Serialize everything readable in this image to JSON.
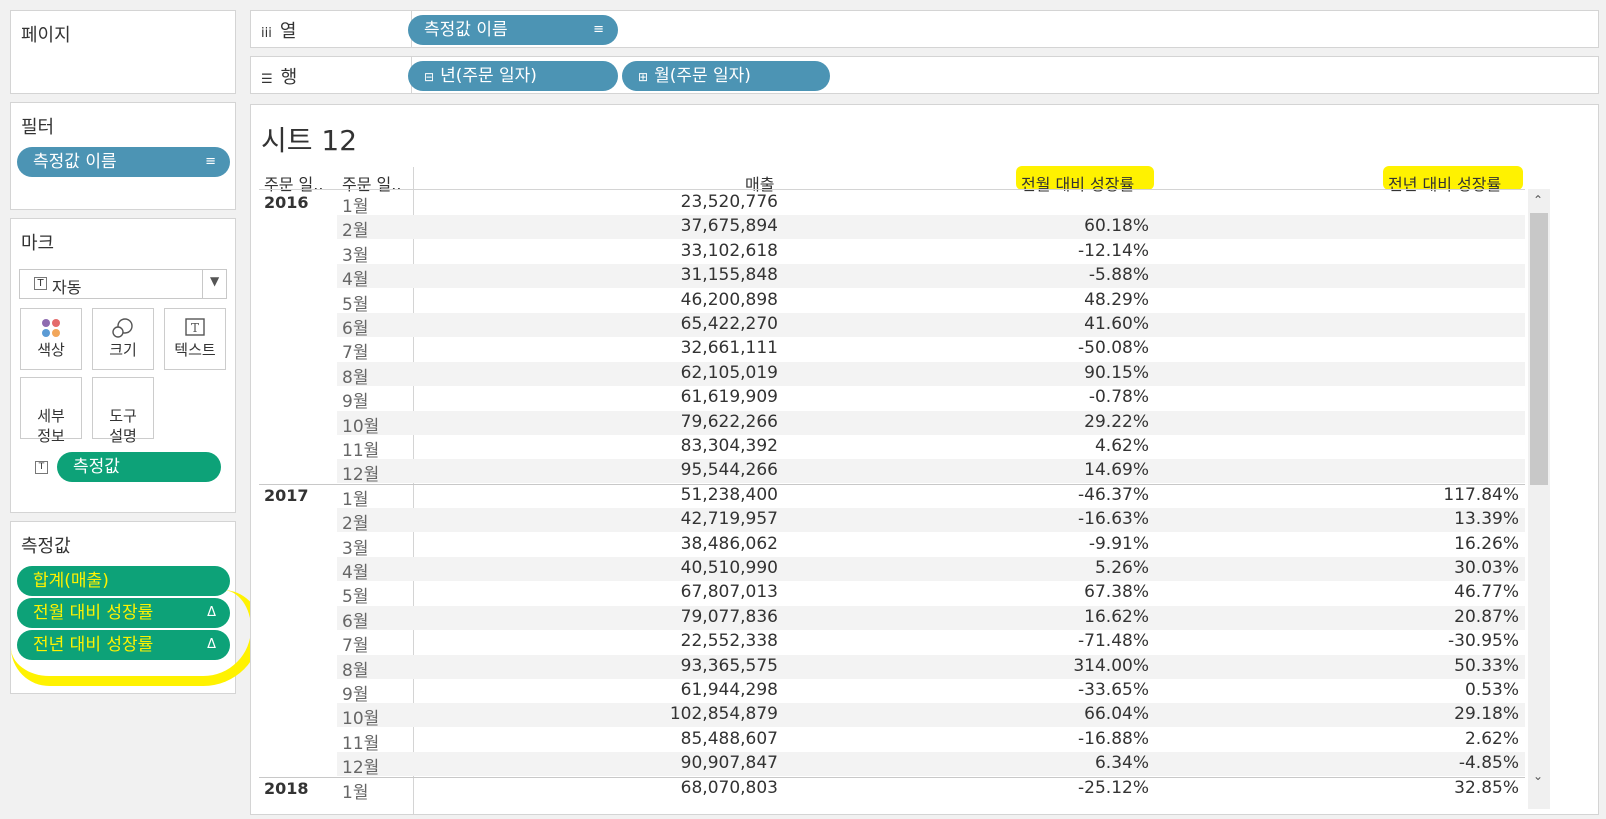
{
  "pages": {
    "title": "페이지"
  },
  "filters": {
    "title": "필터",
    "pill": "측정값 이름"
  },
  "marks": {
    "title": "마크",
    "type_select": "자동",
    "buttons": [
      {
        "label": "색상",
        "icon": "color-dots-icon"
      },
      {
        "label": "크기",
        "icon": "size-circles-icon"
      },
      {
        "label": "텍스트",
        "icon": "text-box-icon"
      },
      {
        "label": "세부\n정보",
        "icon": ""
      },
      {
        "label": "도구\n설명",
        "icon": ""
      }
    ],
    "text_pill": "측정값"
  },
  "measures": {
    "title": "측정값",
    "pills": [
      "합계(매출)",
      "전월 대비 성장률",
      "전년 대비 성장률"
    ],
    "delta_icon": "Δ"
  },
  "columns_shelf": {
    "label": "열",
    "pill": "측정값 이름"
  },
  "rows_shelf": {
    "label": "행",
    "pills": [
      "년(주문 일자)",
      "월(주문 일자)"
    ]
  },
  "sheet": {
    "title": "시트 12",
    "headers": [
      "주문 일..",
      "주문 일..",
      "매출",
      "전월 대비 성장률",
      "전년 대비 성장률"
    ],
    "rows": [
      {
        "year": "2016",
        "month": "1월",
        "sales": "23,520,776",
        "mom": "",
        "yoy": ""
      },
      {
        "year": "",
        "month": "2월",
        "sales": "37,675,894",
        "mom": "60.18%",
        "yoy": ""
      },
      {
        "year": "",
        "month": "3월",
        "sales": "33,102,618",
        "mom": "-12.14%",
        "yoy": ""
      },
      {
        "year": "",
        "month": "4월",
        "sales": "31,155,848",
        "mom": "-5.88%",
        "yoy": ""
      },
      {
        "year": "",
        "month": "5월",
        "sales": "46,200,898",
        "mom": "48.29%",
        "yoy": ""
      },
      {
        "year": "",
        "month": "6월",
        "sales": "65,422,270",
        "mom": "41.60%",
        "yoy": ""
      },
      {
        "year": "",
        "month": "7월",
        "sales": "32,661,111",
        "mom": "-50.08%",
        "yoy": ""
      },
      {
        "year": "",
        "month": "8월",
        "sales": "62,105,019",
        "mom": "90.15%",
        "yoy": ""
      },
      {
        "year": "",
        "month": "9월",
        "sales": "61,619,909",
        "mom": "-0.78%",
        "yoy": ""
      },
      {
        "year": "",
        "month": "10월",
        "sales": "79,622,266",
        "mom": "29.22%",
        "yoy": ""
      },
      {
        "year": "",
        "month": "11월",
        "sales": "83,304,392",
        "mom": "4.62%",
        "yoy": ""
      },
      {
        "year": "",
        "month": "12월",
        "sales": "95,544,266",
        "mom": "14.69%",
        "yoy": ""
      },
      {
        "year": "2017",
        "month": "1월",
        "sales": "51,238,400",
        "mom": "-46.37%",
        "yoy": "117.84%"
      },
      {
        "year": "",
        "month": "2월",
        "sales": "42,719,957",
        "mom": "-16.63%",
        "yoy": "13.39%"
      },
      {
        "year": "",
        "month": "3월",
        "sales": "38,486,062",
        "mom": "-9.91%",
        "yoy": "16.26%"
      },
      {
        "year": "",
        "month": "4월",
        "sales": "40,510,990",
        "mom": "5.26%",
        "yoy": "30.03%"
      },
      {
        "year": "",
        "month": "5월",
        "sales": "67,807,013",
        "mom": "67.38%",
        "yoy": "46.77%"
      },
      {
        "year": "",
        "month": "6월",
        "sales": "79,077,836",
        "mom": "16.62%",
        "yoy": "20.87%"
      },
      {
        "year": "",
        "month": "7월",
        "sales": "22,552,338",
        "mom": "-71.48%",
        "yoy": "-30.95%"
      },
      {
        "year": "",
        "month": "8월",
        "sales": "93,365,575",
        "mom": "314.00%",
        "yoy": "50.33%"
      },
      {
        "year": "",
        "month": "9월",
        "sales": "61,944,298",
        "mom": "-33.65%",
        "yoy": "0.53%"
      },
      {
        "year": "",
        "month": "10월",
        "sales": "102,854,879",
        "mom": "66.04%",
        "yoy": "29.18%"
      },
      {
        "year": "",
        "month": "11월",
        "sales": "85,488,607",
        "mom": "-16.88%",
        "yoy": "2.62%"
      },
      {
        "year": "",
        "month": "12월",
        "sales": "90,907,847",
        "mom": "6.34%",
        "yoy": "-4.85%"
      },
      {
        "year": "2018",
        "month": "1월",
        "sales": "68,070,803",
        "mom": "-25.12%",
        "yoy": "32.85%"
      }
    ]
  },
  "colors": {
    "pill_blue": "#4c94b4",
    "pill_green": "#0da278",
    "highlight": "#fff200"
  }
}
